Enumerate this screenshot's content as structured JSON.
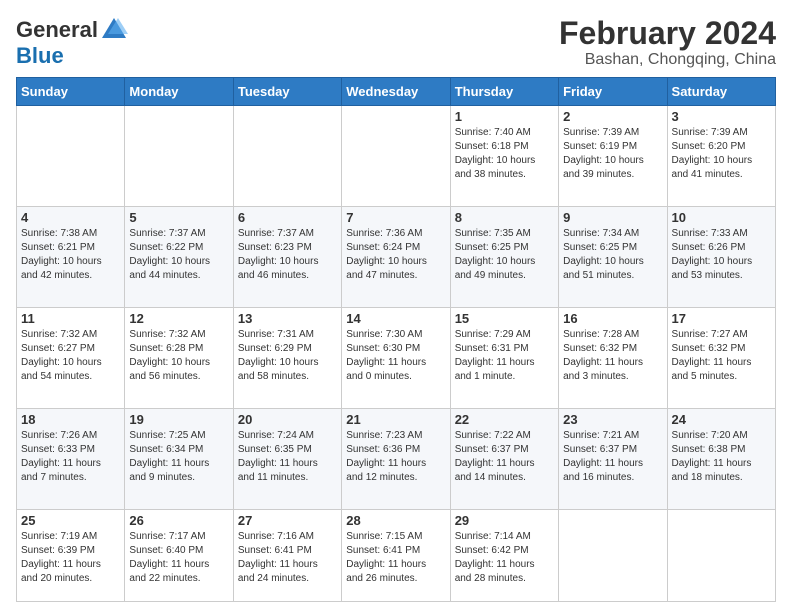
{
  "header": {
    "logo_general": "General",
    "logo_blue": "Blue",
    "month_title": "February 2024",
    "location": "Bashan, Chongqing, China"
  },
  "days_of_week": [
    "Sunday",
    "Monday",
    "Tuesday",
    "Wednesday",
    "Thursday",
    "Friday",
    "Saturday"
  ],
  "weeks": [
    [
      {
        "day": "",
        "info": ""
      },
      {
        "day": "",
        "info": ""
      },
      {
        "day": "",
        "info": ""
      },
      {
        "day": "",
        "info": ""
      },
      {
        "day": "1",
        "info": "Sunrise: 7:40 AM\nSunset: 6:18 PM\nDaylight: 10 hours\nand 38 minutes."
      },
      {
        "day": "2",
        "info": "Sunrise: 7:39 AM\nSunset: 6:19 PM\nDaylight: 10 hours\nand 39 minutes."
      },
      {
        "day": "3",
        "info": "Sunrise: 7:39 AM\nSunset: 6:20 PM\nDaylight: 10 hours\nand 41 minutes."
      }
    ],
    [
      {
        "day": "4",
        "info": "Sunrise: 7:38 AM\nSunset: 6:21 PM\nDaylight: 10 hours\nand 42 minutes."
      },
      {
        "day": "5",
        "info": "Sunrise: 7:37 AM\nSunset: 6:22 PM\nDaylight: 10 hours\nand 44 minutes."
      },
      {
        "day": "6",
        "info": "Sunrise: 7:37 AM\nSunset: 6:23 PM\nDaylight: 10 hours\nand 46 minutes."
      },
      {
        "day": "7",
        "info": "Sunrise: 7:36 AM\nSunset: 6:24 PM\nDaylight: 10 hours\nand 47 minutes."
      },
      {
        "day": "8",
        "info": "Sunrise: 7:35 AM\nSunset: 6:25 PM\nDaylight: 10 hours\nand 49 minutes."
      },
      {
        "day": "9",
        "info": "Sunrise: 7:34 AM\nSunset: 6:25 PM\nDaylight: 10 hours\nand 51 minutes."
      },
      {
        "day": "10",
        "info": "Sunrise: 7:33 AM\nSunset: 6:26 PM\nDaylight: 10 hours\nand 53 minutes."
      }
    ],
    [
      {
        "day": "11",
        "info": "Sunrise: 7:32 AM\nSunset: 6:27 PM\nDaylight: 10 hours\nand 54 minutes."
      },
      {
        "day": "12",
        "info": "Sunrise: 7:32 AM\nSunset: 6:28 PM\nDaylight: 10 hours\nand 56 minutes."
      },
      {
        "day": "13",
        "info": "Sunrise: 7:31 AM\nSunset: 6:29 PM\nDaylight: 10 hours\nand 58 minutes."
      },
      {
        "day": "14",
        "info": "Sunrise: 7:30 AM\nSunset: 6:30 PM\nDaylight: 11 hours\nand 0 minutes."
      },
      {
        "day": "15",
        "info": "Sunrise: 7:29 AM\nSunset: 6:31 PM\nDaylight: 11 hours\nand 1 minute."
      },
      {
        "day": "16",
        "info": "Sunrise: 7:28 AM\nSunset: 6:32 PM\nDaylight: 11 hours\nand 3 minutes."
      },
      {
        "day": "17",
        "info": "Sunrise: 7:27 AM\nSunset: 6:32 PM\nDaylight: 11 hours\nand 5 minutes."
      }
    ],
    [
      {
        "day": "18",
        "info": "Sunrise: 7:26 AM\nSunset: 6:33 PM\nDaylight: 11 hours\nand 7 minutes."
      },
      {
        "day": "19",
        "info": "Sunrise: 7:25 AM\nSunset: 6:34 PM\nDaylight: 11 hours\nand 9 minutes."
      },
      {
        "day": "20",
        "info": "Sunrise: 7:24 AM\nSunset: 6:35 PM\nDaylight: 11 hours\nand 11 minutes."
      },
      {
        "day": "21",
        "info": "Sunrise: 7:23 AM\nSunset: 6:36 PM\nDaylight: 11 hours\nand 12 minutes."
      },
      {
        "day": "22",
        "info": "Sunrise: 7:22 AM\nSunset: 6:37 PM\nDaylight: 11 hours\nand 14 minutes."
      },
      {
        "day": "23",
        "info": "Sunrise: 7:21 AM\nSunset: 6:37 PM\nDaylight: 11 hours\nand 16 minutes."
      },
      {
        "day": "24",
        "info": "Sunrise: 7:20 AM\nSunset: 6:38 PM\nDaylight: 11 hours\nand 18 minutes."
      }
    ],
    [
      {
        "day": "25",
        "info": "Sunrise: 7:19 AM\nSunset: 6:39 PM\nDaylight: 11 hours\nand 20 minutes."
      },
      {
        "day": "26",
        "info": "Sunrise: 7:17 AM\nSunset: 6:40 PM\nDaylight: 11 hours\nand 22 minutes."
      },
      {
        "day": "27",
        "info": "Sunrise: 7:16 AM\nSunset: 6:41 PM\nDaylight: 11 hours\nand 24 minutes."
      },
      {
        "day": "28",
        "info": "Sunrise: 7:15 AM\nSunset: 6:41 PM\nDaylight: 11 hours\nand 26 minutes."
      },
      {
        "day": "29",
        "info": "Sunrise: 7:14 AM\nSunset: 6:42 PM\nDaylight: 11 hours\nand 28 minutes."
      },
      {
        "day": "",
        "info": ""
      },
      {
        "day": "",
        "info": ""
      }
    ]
  ]
}
